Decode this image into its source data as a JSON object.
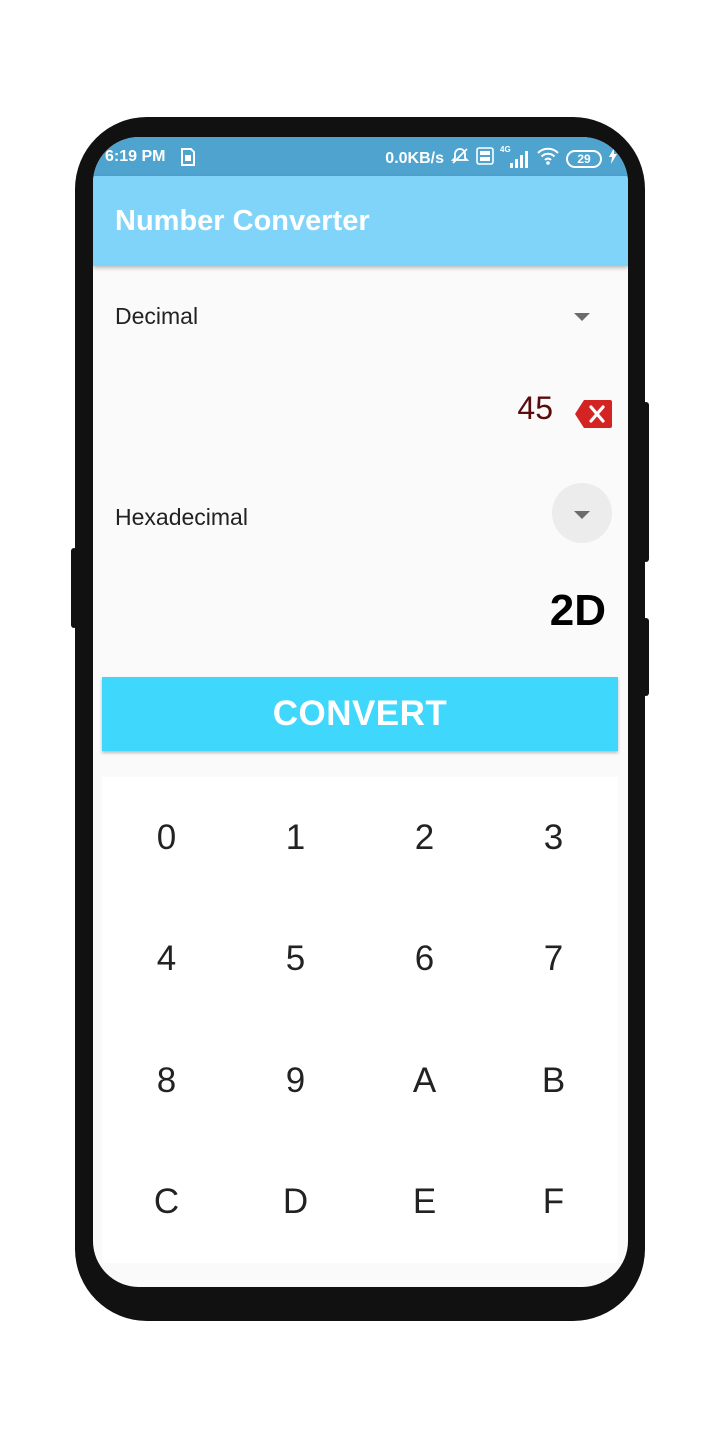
{
  "status_bar": {
    "time": "6:19 PM",
    "network_speed": "0.0KB/s",
    "signal_type": "4G",
    "battery": "29",
    "icons": [
      "sim-card-icon",
      "mute-icon",
      "volte-icon",
      "signal-icon",
      "wifi-icon",
      "battery-icon",
      "charging-icon"
    ]
  },
  "app_bar": {
    "title": "Number Converter"
  },
  "from": {
    "base": "Decimal",
    "value": "45"
  },
  "to": {
    "base": "Hexadecimal",
    "value": "2D"
  },
  "convert_label": "CONVERT",
  "keypad": {
    "rows": [
      [
        "0",
        "1",
        "2",
        "3"
      ],
      [
        "4",
        "5",
        "6",
        "7"
      ],
      [
        "8",
        "9",
        "A",
        "B"
      ],
      [
        "C",
        "D",
        "E",
        "F"
      ]
    ]
  },
  "colors": {
    "status_bar": "#4fa3cf",
    "app_bar": "#81d4f9",
    "convert_button": "#40d7fc",
    "backspace": "#d32323",
    "input_text": "#5a0c0c"
  }
}
